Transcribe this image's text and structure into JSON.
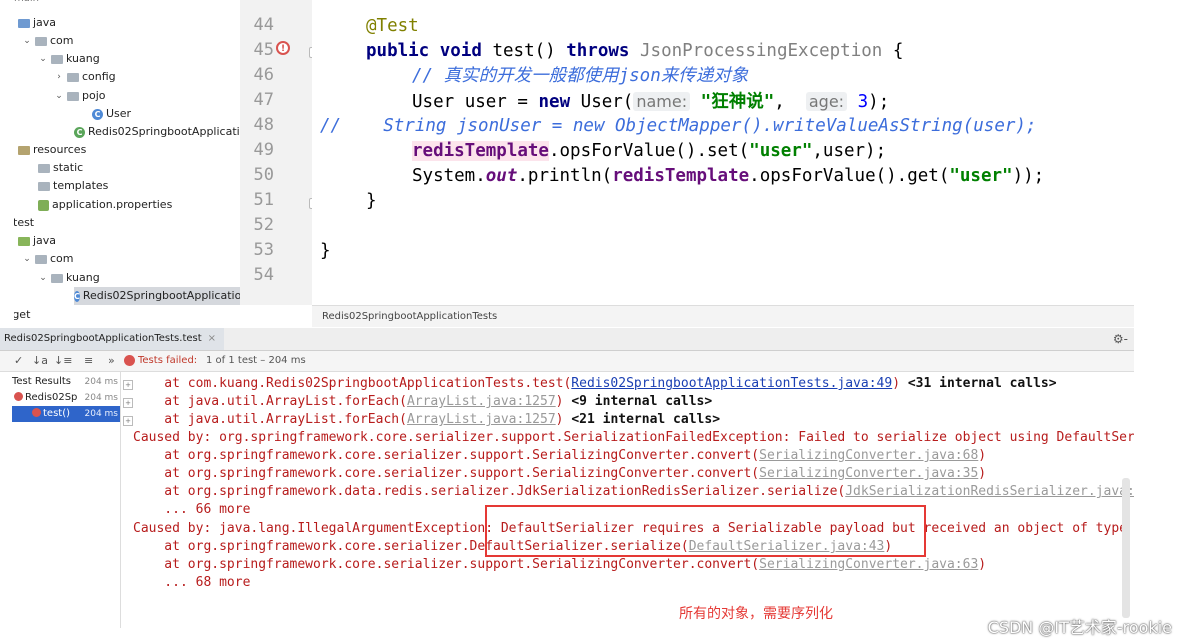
{
  "project_tree": {
    "top_label": "main",
    "items": [
      {
        "label": "java",
        "arrow": ""
      },
      {
        "label": "com",
        "arrow": "⌄"
      },
      {
        "label": "kuang",
        "arrow": "⌄"
      },
      {
        "label": "config",
        "arrow": "›"
      },
      {
        "label": "pojo",
        "arrow": "⌄"
      },
      {
        "label": "User",
        "arrow": ""
      },
      {
        "label": "Redis02SpringbootApplication",
        "arrow": ""
      },
      {
        "label": "resources",
        "arrow": ""
      },
      {
        "label": "static",
        "arrow": ""
      },
      {
        "label": "templates",
        "arrow": ""
      },
      {
        "label": "application.properties",
        "arrow": ""
      },
      {
        "label": "test",
        "arrow": ""
      },
      {
        "label": "java",
        "arrow": ""
      },
      {
        "label": "com",
        "arrow": "⌄"
      },
      {
        "label": "kuang",
        "arrow": "⌄"
      },
      {
        "label": "Redis02SpringbootApplication",
        "arrow": ""
      },
      {
        "label": "rget",
        "arrow": ""
      }
    ]
  },
  "editor": {
    "line_numbers": [
      "44",
      "45",
      "46",
      "47",
      "48",
      "49",
      "50",
      "51",
      "52",
      "53",
      "54"
    ],
    "line44": {
      "annotation": "@Test"
    },
    "line45": {
      "kw1": "public",
      "kw2": "void",
      "method": "test()",
      "kw3": "throws",
      "exception": "JsonProcessingException",
      "brace": "{"
    },
    "line46": {
      "comment": "// 真实的开发一般都使用json来传递对象"
    },
    "line47": {
      "type": "User",
      "var": "user",
      "eq": "=",
      "kw": "new",
      "ctor": "User(",
      "hint1": "name:",
      "str": "\"狂神说\"",
      "comma": ",",
      "hint2": "age:",
      "num": "3",
      "end": ");"
    },
    "line48": {
      "prefix": "//",
      "text": "String jsonUser = new ObjectMapper().writeValueAsString(user);"
    },
    "line49": {
      "field": "redisTemplate",
      "call1": ".opsForValue().set(",
      "str": "\"user\"",
      "rest": ",user);"
    },
    "line50": {
      "cls": "System.",
      "out": "out",
      "call": ".println(",
      "field": "redisTemplate",
      "call2": ".opsForValue().get(",
      "str": "\"user\"",
      "end": "));"
    },
    "line51": {
      "brace": "}"
    },
    "line53": {
      "brace": "}"
    },
    "breakpoint_glyph": "!",
    "breadcrumb": "Redis02SpringbootApplicationTests"
  },
  "run_panel": {
    "tab_label": "Redis02SpringbootApplicationTests.test",
    "tab_close": "×",
    "gear": "⚙-",
    "toolbar": {
      "icons": [
        "↓a",
        "↓≡",
        "≡",
        "»"
      ],
      "failed_label": "Tests failed:",
      "failed_count": "1 of 1 test – 204 ms"
    },
    "test_tree": [
      {
        "label": "Test Results",
        "time": "204 ms"
      },
      {
        "label": "Redis02Sp",
        "time": "204 ms"
      },
      {
        "label": "test()",
        "time": "204 ms"
      }
    ]
  },
  "console": {
    "l1": {
      "pre": "    at com.kuang.Redis02SpringbootApplicationTests.test(",
      "link": "Redis02SpringbootApplicationTests.java:49",
      "post": ") ",
      "bold": "<31 internal calls>"
    },
    "l2": {
      "pre": "    at java.util.ArrayList.forEach(",
      "link": "ArrayList.java:1257",
      "post": ") ",
      "bold": "<9 internal calls>"
    },
    "l3": {
      "pre": "    at java.util.ArrayList.forEach(",
      "link": "ArrayList.java:1257",
      "post": ") ",
      "bold": "<21 internal calls>"
    },
    "l4": "Caused by: org.springframework.core.serializer.support.SerializationFailedException: Failed to serialize object using DefaultSer",
    "l5": {
      "pre": "    at org.springframework.core.serializer.support.SerializingConverter.convert(",
      "link": "SerializingConverter.java:68",
      "post": ")"
    },
    "l6": {
      "pre": "    at org.springframework.core.serializer.support.SerializingConverter.convert(",
      "link": "SerializingConverter.java:35",
      "post": ")"
    },
    "l7": {
      "pre": "    at org.springframework.data.redis.serializer.JdkSerializationRedisSerializer.serialize(",
      "link": "JdkSerializationRedisSerializer.java:",
      "post": ""
    },
    "l8": "    ... 66 more",
    "l9": "Caused by: java.lang.IllegalArgumentException: DefaultSerializer requires a Serializable payload but received an object of type",
    "l10": {
      "pre": "    at org.springframework.core.serializer.DefaultSerializer.serialize(",
      "link": "DefaultSerializer.java:43",
      "post": ")"
    },
    "l11": {
      "pre": "    at org.springframework.core.serializer.support.SerializingConverter.convert(",
      "link": "SerializingConverter.java:63",
      "post": ")"
    },
    "l12": "    ... 68 more"
  },
  "annotation_note": "所有的对象，需要序列化",
  "watermark": "CSDN @IT艺术家-rookie",
  "colors": {
    "error_red": "#b71c1c",
    "link_blue": "#1a3fb3",
    "highlight_box": "#e53935",
    "selection": "#2f65ca"
  }
}
